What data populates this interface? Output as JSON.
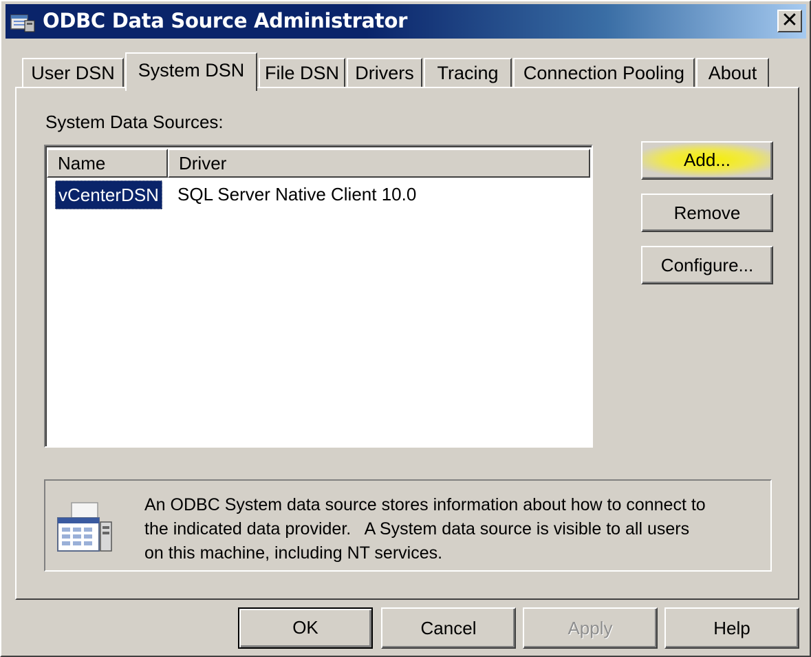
{
  "window": {
    "title": "ODBC Data Source Administrator",
    "close_glyph": "✕"
  },
  "tabs": [
    {
      "label": "User DSN"
    },
    {
      "label": "System DSN"
    },
    {
      "label": "File DSN"
    },
    {
      "label": "Drivers"
    },
    {
      "label": "Tracing"
    },
    {
      "label": "Connection Pooling"
    },
    {
      "label": "About"
    }
  ],
  "active_tab": "System DSN",
  "section": {
    "label": "System Data Sources:"
  },
  "table": {
    "columns": [
      "Name",
      "Driver"
    ],
    "rows": [
      {
        "name": "vCenterDSN",
        "driver": "SQL Server Native Client 10.0"
      }
    ]
  },
  "side_buttons": {
    "add": "Add...",
    "remove": "Remove",
    "configure": "Configure..."
  },
  "info": {
    "icon": "data-source-icon",
    "text_line1": "An ODBC System data source stores information about how to connect to",
    "text_line2": "the indicated data provider.   A System data source is visible to all users",
    "text_line3": "on this machine, including NT services."
  },
  "footer_buttons": {
    "ok": "OK",
    "cancel": "Cancel",
    "apply": "Apply",
    "help": "Help"
  },
  "colors": {
    "titlebar": "#0a246a",
    "selection": "#0a246a",
    "highlight": "#f5ef00",
    "face": "#d4d0c8"
  }
}
